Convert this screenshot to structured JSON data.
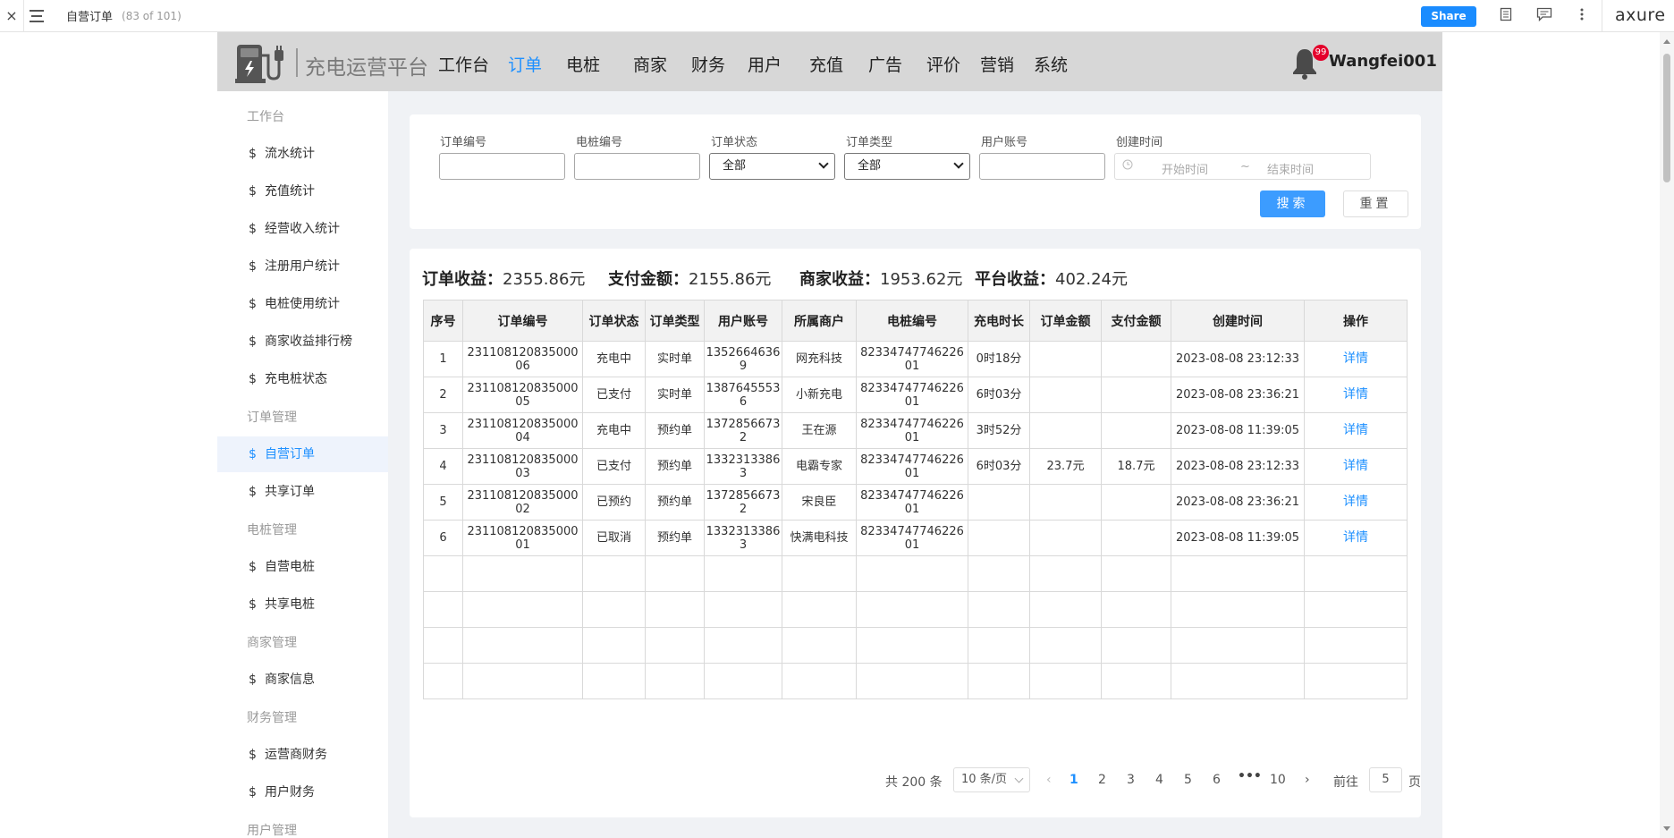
{
  "axure": {
    "page_title": "自营订单",
    "page_count": "(83 of 101)",
    "share_label": "Share",
    "logo": "axure",
    "close_glyph": "×"
  },
  "header": {
    "brand": "充电运营平台",
    "nav": [
      "工作台",
      "订单",
      "电桩",
      "商家",
      "财务",
      "用户",
      "充值",
      "广告",
      "评价",
      "营销",
      "系统"
    ],
    "active_nav": "订单",
    "notification_count": "99",
    "username": "Wangfei001"
  },
  "sidebar": {
    "groups": [
      {
        "title": "工作台",
        "items": [
          "流水统计",
          "充值统计",
          "经营收入统计",
          "注册用户统计",
          "电桩使用统计",
          "商家收益排行榜",
          "充电桩状态"
        ]
      },
      {
        "title": "订单管理",
        "items": [
          "自营订单",
          "共享订单"
        ]
      },
      {
        "title": "电桩管理",
        "items": [
          "自营电桩",
          "共享电桩"
        ]
      },
      {
        "title": "商家管理",
        "items": [
          "商家信息"
        ]
      },
      {
        "title": "财务管理",
        "items": [
          "运营商财务",
          "用户财务"
        ]
      },
      {
        "title": "用户管理",
        "items": []
      }
    ],
    "item_prefix": "$",
    "active_item": "自营订单"
  },
  "filters": {
    "order_no_label": "订单编号",
    "pile_no_label": "电桩编号",
    "status_label": "订单状态",
    "status_value": "全部",
    "type_label": "订单类型",
    "type_value": "全部",
    "account_label": "用户账号",
    "created_label": "创建时间",
    "start_placeholder": "开始时间",
    "range_sep": "~",
    "end_placeholder": "结束时间",
    "search_button": "搜索",
    "reset_button": "重置"
  },
  "stats": {
    "order_income_label": "订单收益：",
    "order_income": "2355.86元",
    "paid_label": "支付金额：",
    "paid": "2155.86元",
    "merchant_label": "商家收益：",
    "merchant": "1953.62元",
    "platform_label": "平台收益：",
    "platform": "402.24元"
  },
  "table": {
    "columns": [
      "序号",
      "订单编号",
      "订单状态",
      "订单类型",
      "用户账号",
      "所属商户",
      "电桩编号",
      "充电时长",
      "订单金额",
      "支付金额",
      "创建时间",
      "操作"
    ],
    "rows": [
      [
        "1",
        "23110812083500006",
        "充电中",
        "实时单",
        "13526646369",
        "网充科技",
        "8233474774622601",
        "0时18分",
        "",
        "",
        "2023-08-08 23:12:33",
        "详情"
      ],
      [
        "2",
        "23110812083500005",
        "已支付",
        "实时单",
        "13876455536",
        "小新充电",
        "8233474774622601",
        "6时03分",
        "",
        "",
        "2023-08-08 23:36:21",
        "详情"
      ],
      [
        "3",
        "23110812083500004",
        "充电中",
        "预约单",
        "13728566732",
        "王在源",
        "8233474774622601",
        "3时52分",
        "",
        "",
        "2023-08-08 11:39:05",
        "详情"
      ],
      [
        "4",
        "23110812083500003",
        "已支付",
        "预约单",
        "13323133863",
        "电霸专家",
        "8233474774622601",
        "6时03分",
        "23.7元",
        "18.7元",
        "2023-08-08 23:12:33",
        "详情"
      ],
      [
        "5",
        "23110812083500002",
        "已预约",
        "预约单",
        "13728566732",
        "宋良臣",
        "8233474774622601",
        "",
        "",
        "",
        "2023-08-08 23:36:21",
        "详情"
      ],
      [
        "6",
        "23110812083500001",
        "已取消",
        "预约单",
        "13323133863",
        "快满电科技",
        "8233474774622601",
        "",
        "",
        "",
        "2023-08-08 11:39:05",
        "详情"
      ]
    ],
    "empty_rows": 4
  },
  "pagination": {
    "total": "共 200 条",
    "page_size": "10 条/页",
    "pages": [
      "1",
      "2",
      "3",
      "4",
      "5",
      "6"
    ],
    "ellipsis": "•••",
    "last_page": "10",
    "current": "1",
    "goto_label": "前往",
    "goto_value": "5",
    "page_unit": "页"
  }
}
